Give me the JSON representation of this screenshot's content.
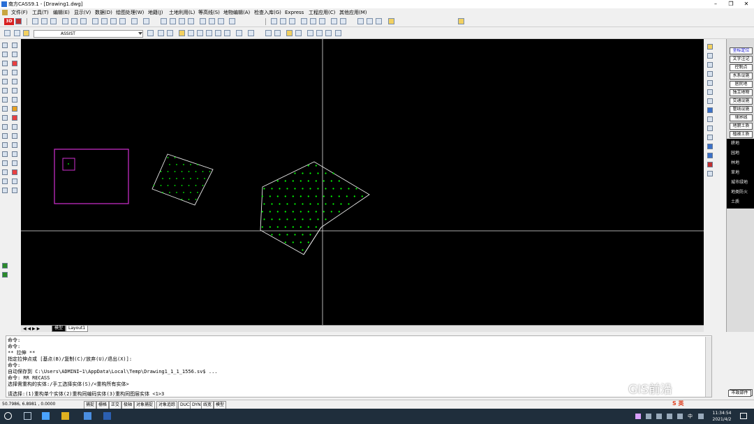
{
  "app": {
    "title": "南方CASS9.1 - [Drawing1.dwg]"
  },
  "window_controls": {
    "minimize": "–",
    "restore": "❐",
    "close": "✕"
  },
  "menu": [
    "文件(F)",
    "工具(T)",
    "编辑(E)",
    "显示(V)",
    "数据(D)",
    "绘图处理(W)",
    "地籍(J)",
    "土地利用(L)",
    "等高线(S)",
    "地物编辑(A)",
    "检查入库(G)",
    "Express",
    "工程应用(C)",
    "其他应用(M)"
  ],
  "toolbar": {
    "badge_3d": "3D",
    "layer_name": "ASSIST"
  },
  "layout_tabs": {
    "model": "模型",
    "layout1": "Layout1"
  },
  "right_panel": {
    "buttons": [
      "坐标定位",
      "文字注记",
      "控制点",
      "水系设施",
      "居民地",
      "独立地物",
      "交通设施",
      "管线设施",
      "境界线",
      "地貌土质",
      "植被土质"
    ],
    "sub_items": [
      "耕地",
      "园地",
      "林地",
      "草地",
      "城市绿地",
      "地类防火",
      "土质"
    ],
    "bottom_button": "市政部件"
  },
  "command": {
    "lines": [
      "命令:",
      "命令:",
      "** 拉伸 **",
      "指定拉伸点或 [基点(B)/复制(C)/放弃(U)/退出(X)]:",
      "命令:",
      "自动保存到 C:\\Users\\ADMINI~1\\AppData\\Local\\Temp\\Drawing1_1_1_1556.sv$ ...",
      "命令: RR RECASS",
      "选择需重构的实体:/手工选择实体(S)/<重构所有实体>",
      "请选择:(1)重构单个实体(2)重构同编码实体(3)重构同图层实体 <1>3"
    ]
  },
  "status": {
    "coords": "50.7986, 6.8981 , 0.0000",
    "toggles": [
      "捕捉",
      "栅格",
      "正交",
      "极轴",
      "对象捕捉",
      "对象追踪",
      "DUCS",
      "DYN",
      "线宽",
      "模型"
    ]
  },
  "taskbar": {
    "time": "11:34:54",
    "date": "2021/4/2",
    "ime": "S 英"
  },
  "watermark": "GIS前沿",
  "colors": {
    "canvas": "#000000",
    "magenta": "#d030d0",
    "points": "#00ff00",
    "boundary": "#e8e8e8",
    "taskbar": "#1f2e3c"
  }
}
